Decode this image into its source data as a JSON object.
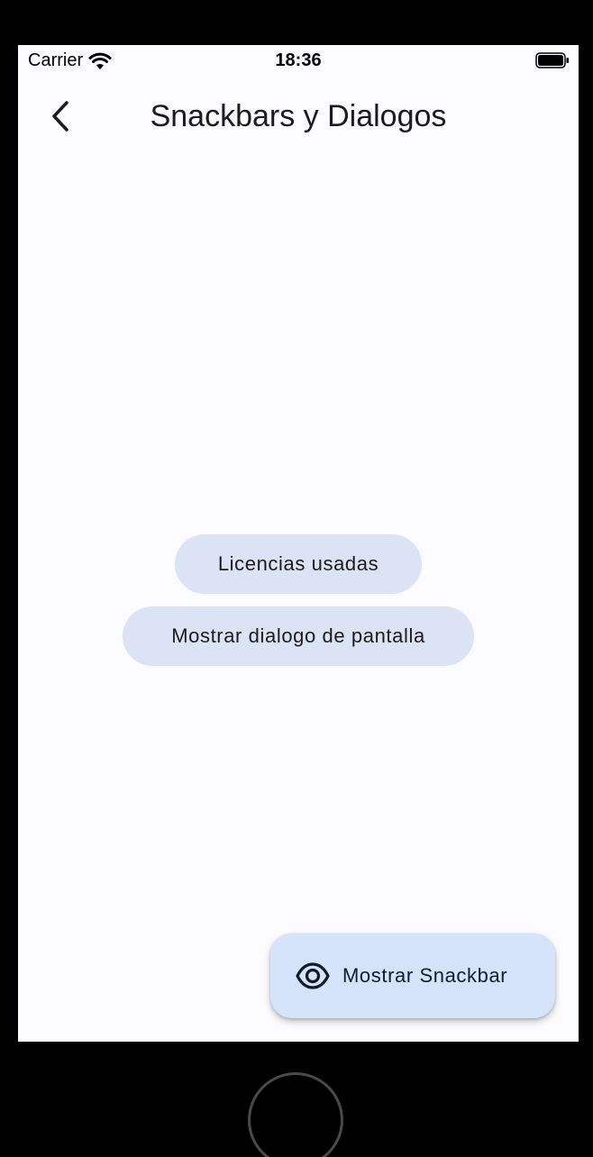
{
  "status_bar": {
    "carrier": "Carrier",
    "time": "18:36",
    "wifi_icon": "wifi-icon",
    "battery_icon": "battery-full-icon"
  },
  "app_bar": {
    "back_icon": "chevron-left-icon",
    "title": "Snackbars y Dialogos"
  },
  "main": {
    "buttons": [
      {
        "label": "Licencias usadas"
      },
      {
        "label": "Mostrar dialogo de pantalla"
      }
    ]
  },
  "fab": {
    "icon": "eye-icon",
    "label": "Mostrar Snackbar"
  },
  "colors": {
    "background": "#fcfcff",
    "tonal_button": "#dbe3f4",
    "fab": "#d5e3fb",
    "text": "#1b1b1f"
  }
}
